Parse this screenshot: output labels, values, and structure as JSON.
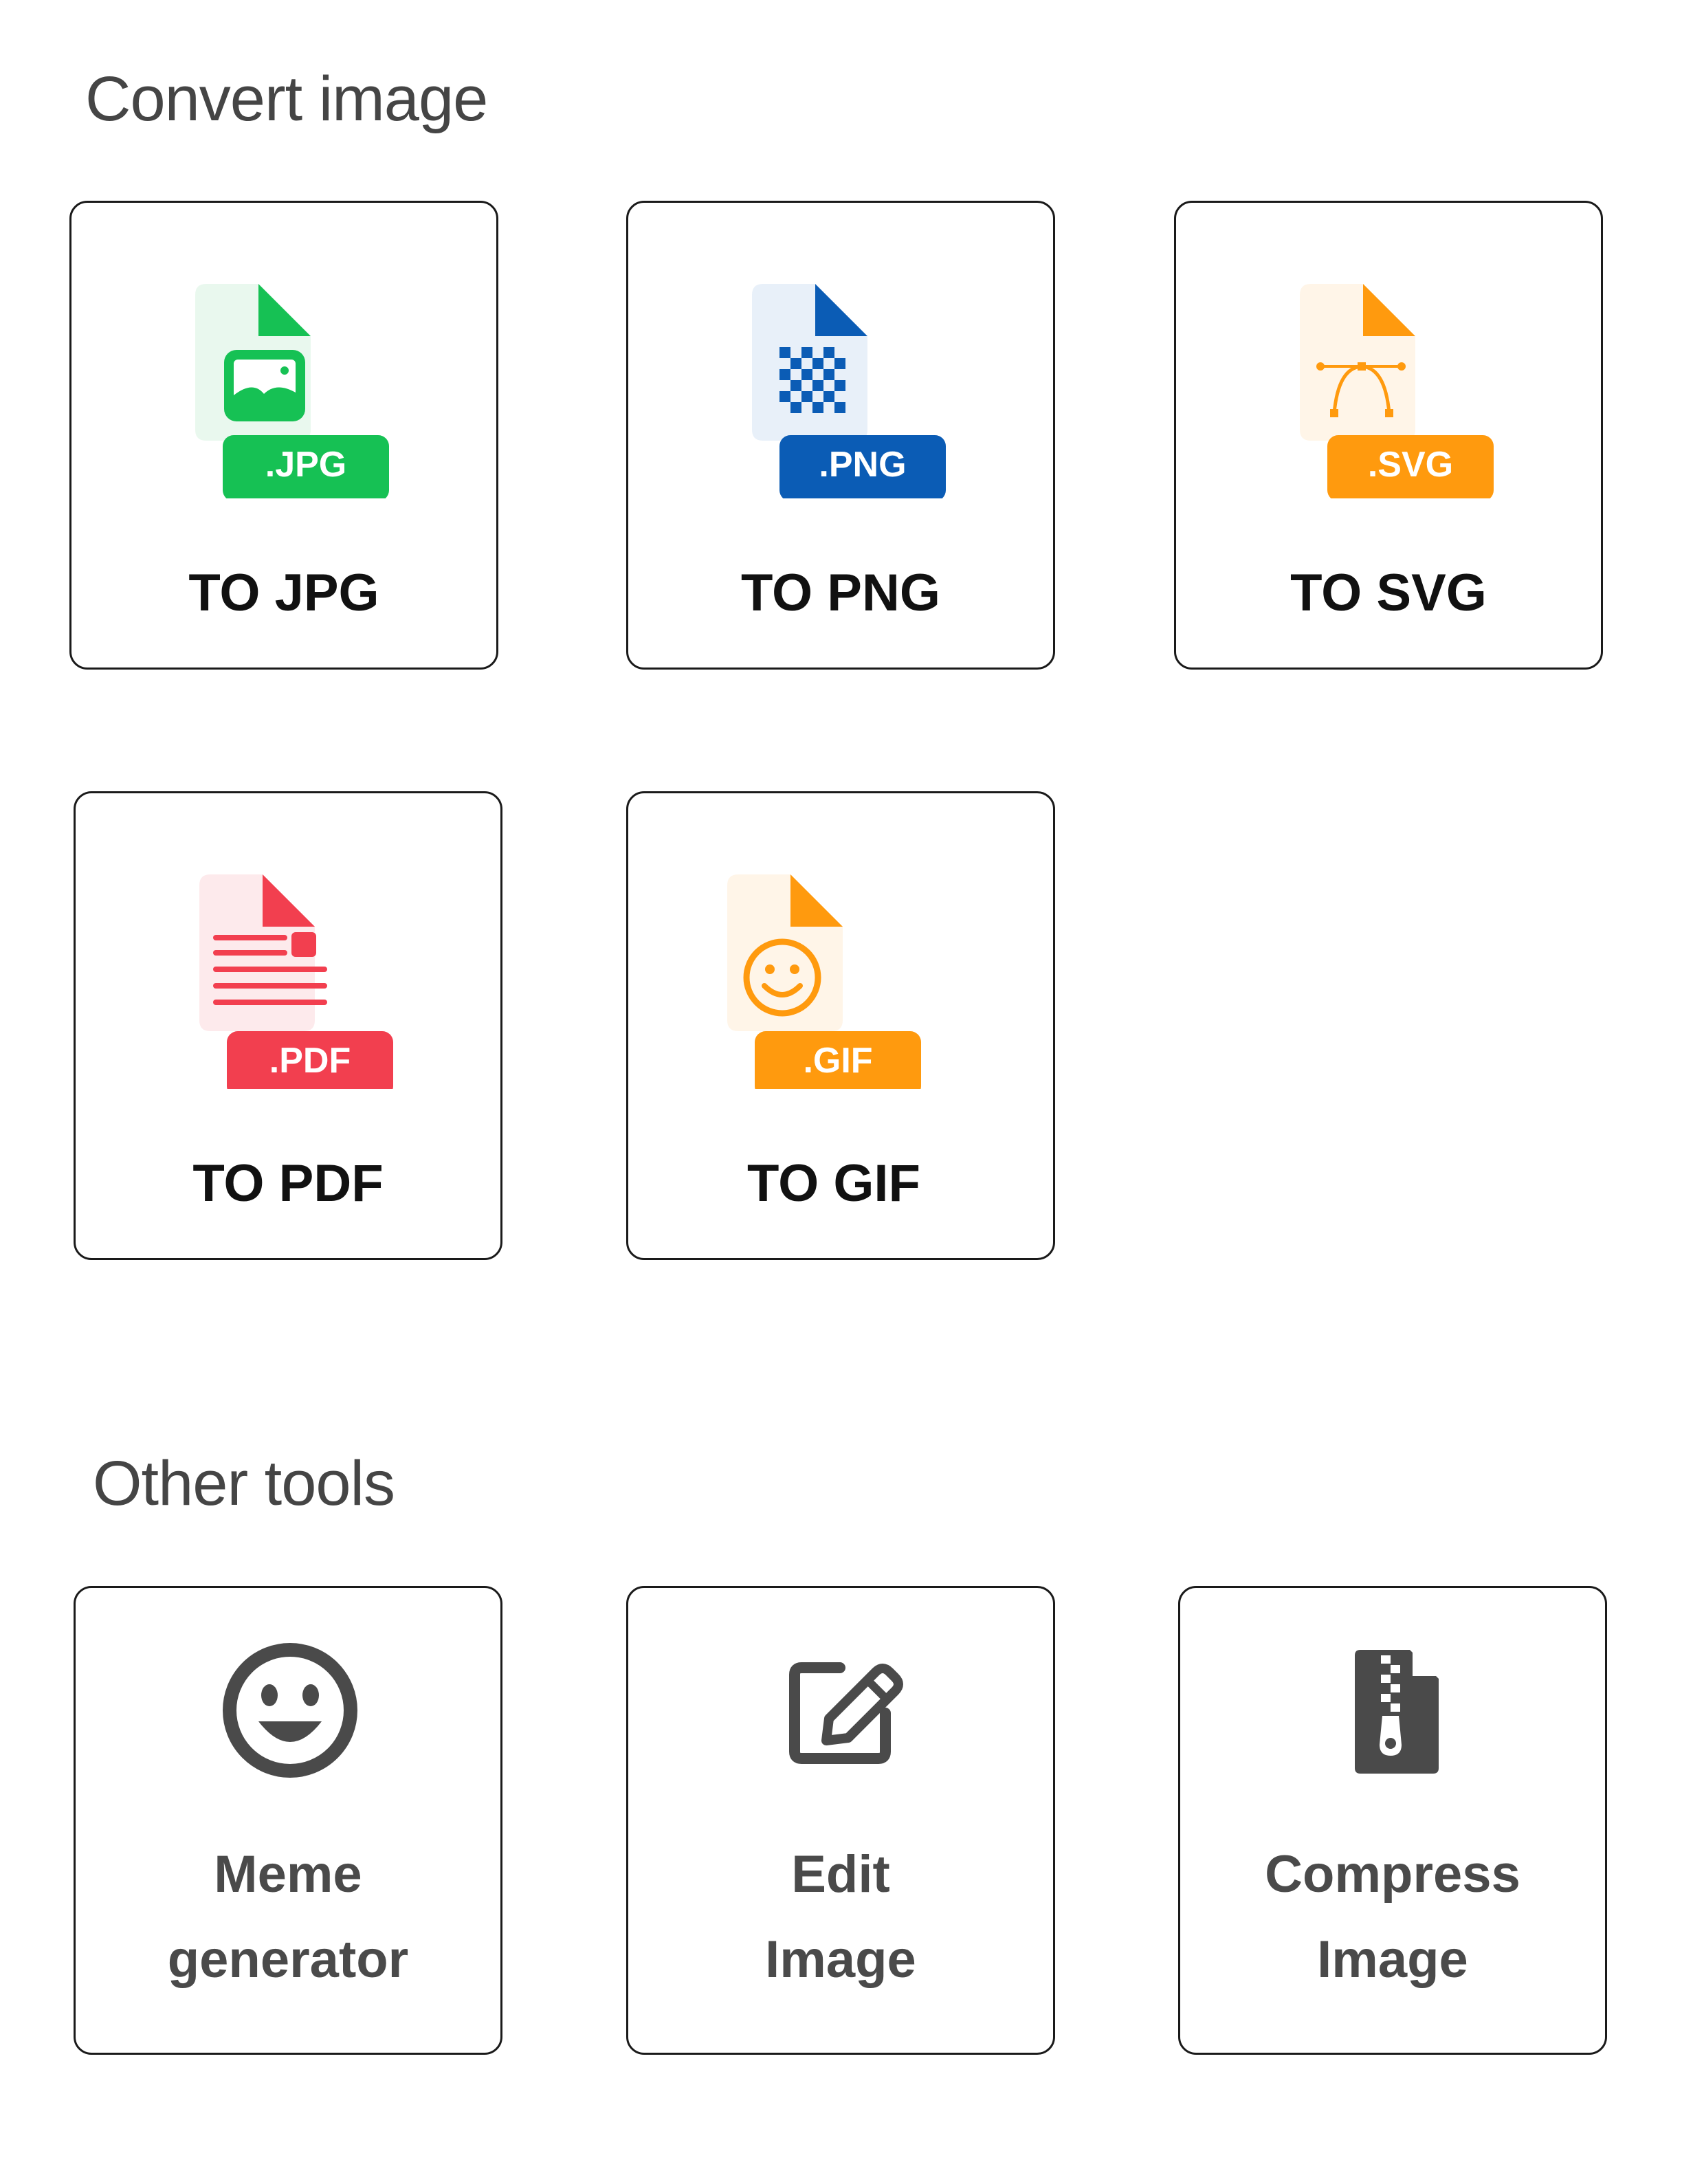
{
  "convert_section": {
    "title": "Convert image",
    "cards": [
      {
        "label": "TO JPG",
        "badge": ".JPG",
        "icon": "jpg-file-icon",
        "accent": "#16C154",
        "tint": "#E9F8EE"
      },
      {
        "label": "TO PNG",
        "badge": ".PNG",
        "icon": "png-file-icon",
        "accent": "#0B5CB5",
        "tint": "#E8F0F9"
      },
      {
        "label": "TO SVG",
        "badge": ".SVG",
        "icon": "svg-file-icon",
        "accent": "#FF9A0E",
        "tint": "#FFF5E8"
      },
      {
        "label": "TO PDF",
        "badge": ".PDF",
        "icon": "pdf-file-icon",
        "accent": "#F23F4F",
        "tint": "#FDEAEC"
      },
      {
        "label": "TO GIF",
        "badge": ".GIF",
        "icon": "gif-file-icon",
        "accent": "#FF9A0E",
        "tint": "#FFF5E8"
      }
    ]
  },
  "other_section": {
    "title": "Other tools",
    "tools": [
      {
        "line1": "Meme",
        "line2": "generator",
        "icon": "smiley-face-icon"
      },
      {
        "line1": "Edit",
        "line2": "Image",
        "icon": "edit-pencil-icon"
      },
      {
        "line1": "Compress",
        "line2": "Image",
        "icon": "zip-file-icon"
      }
    ]
  },
  "colors": {
    "text_dark": "#111111",
    "text_gray": "#4A4A4A",
    "tool_icon": "#4A4A4A",
    "card_border": "#1A1A1A"
  }
}
